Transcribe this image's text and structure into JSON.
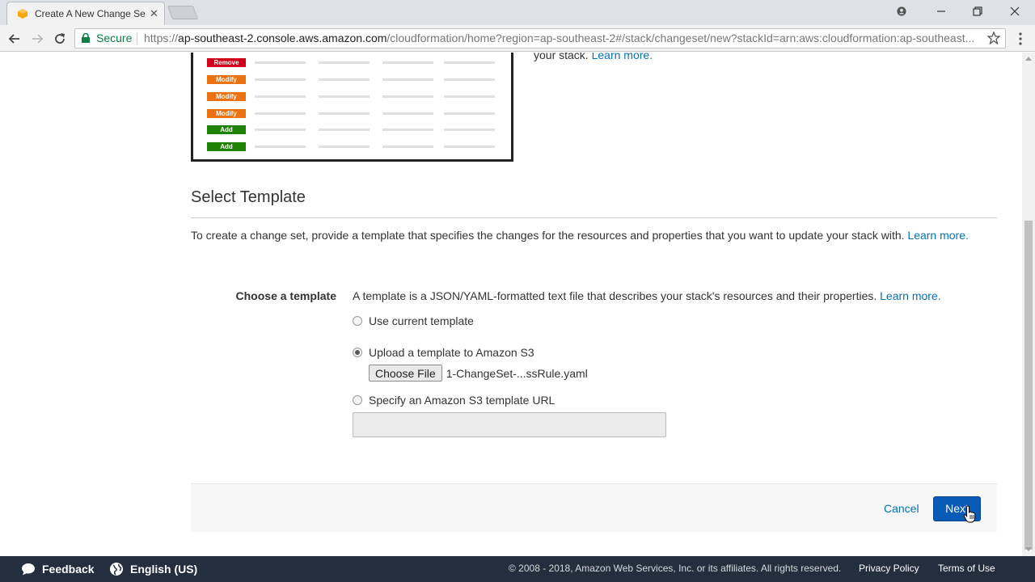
{
  "browser": {
    "tab_title": "Create A New Change Se",
    "secure_label": "Secure",
    "url_prefix": "https://",
    "url_host": "ap-southeast-2.console.aws.amazon.com",
    "url_path": "/cloudformation/home?region=ap-southeast-2#/stack/changeset/new?stackId=arn:aws:cloudformation:ap-southeast..."
  },
  "illustration": {
    "badges": [
      "Remove",
      "Modify",
      "Modify",
      "Modify",
      "Add",
      "Add"
    ]
  },
  "intro": {
    "text_tail": "your stack.",
    "learn_more": "Learn more."
  },
  "section": {
    "title": "Select Template",
    "description": "To create a change set, provide a template that specifies the changes for the resources and properties that you want to update your stack with.",
    "learn_more": "Learn more."
  },
  "template": {
    "label": "Choose a template",
    "description": "A template is a JSON/YAML-formatted text file that describes your stack's resources and their properties.",
    "learn_more": "Learn more.",
    "options": [
      {
        "label": "Use current template",
        "checked": false
      },
      {
        "label": "Upload a template to Amazon S3",
        "checked": true
      },
      {
        "label": "Specify an Amazon S3 template URL",
        "checked": false
      }
    ],
    "choose_file_label": "Choose File",
    "file_name": "1-ChangeSet-...ssRule.yaml",
    "s3_url_value": ""
  },
  "actions": {
    "cancel": "Cancel",
    "next": "Next"
  },
  "footer": {
    "feedback": "Feedback",
    "language": "English (US)",
    "copyright": "© 2008 - 2018, Amazon Web Services, Inc. or its affiliates. All rights reserved.",
    "privacy": "Privacy Policy",
    "terms": "Terms of Use"
  },
  "colors": {
    "accent": "#0073bb",
    "primary_button": "#0a5bb7",
    "footer_bg": "#232f3e"
  }
}
